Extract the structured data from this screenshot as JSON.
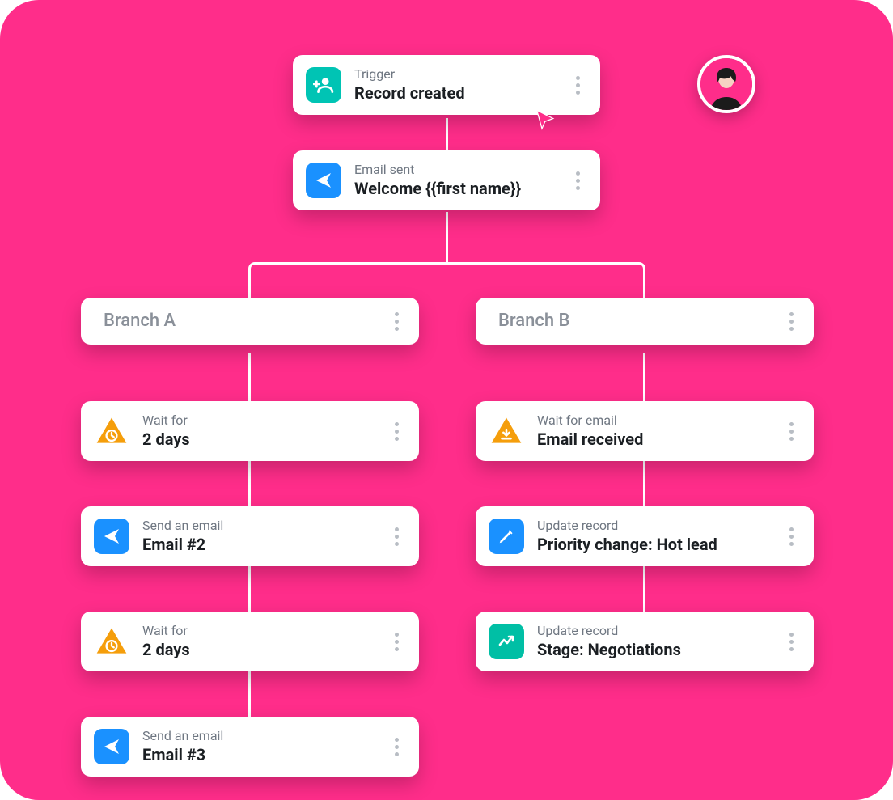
{
  "avatar": {
    "present": true
  },
  "trigger": {
    "label": "Trigger",
    "title": "Record created",
    "icon": "person-add",
    "icon_bg": "teal"
  },
  "email_sent": {
    "label": "Email sent",
    "title": "Welcome {{first name}}",
    "icon": "send",
    "icon_bg": "blue"
  },
  "branches": {
    "a": {
      "header": "Branch A",
      "steps": [
        {
          "label": "Wait for",
          "title": "2 days",
          "icon": "wait-clock"
        },
        {
          "label": "Send an email",
          "title": "Email #2",
          "icon": "send",
          "icon_bg": "blue"
        },
        {
          "label": "Wait for",
          "title": "2 days",
          "icon": "wait-clock"
        },
        {
          "label": "Send an email",
          "title": "Email #3",
          "icon": "send",
          "icon_bg": "blue"
        }
      ]
    },
    "b": {
      "header": "Branch B",
      "steps": [
        {
          "label": "Wait for email",
          "title": "Email received",
          "icon": "wait-download"
        },
        {
          "label": "Update record",
          "title": "Priority change: Hot lead",
          "icon": "edit",
          "icon_bg": "blue"
        },
        {
          "label": "Update record",
          "title": "Stage: Negotiations",
          "icon": "trend",
          "icon_bg": "circle-teal"
        }
      ]
    }
  },
  "cursor": {
    "present": true
  }
}
